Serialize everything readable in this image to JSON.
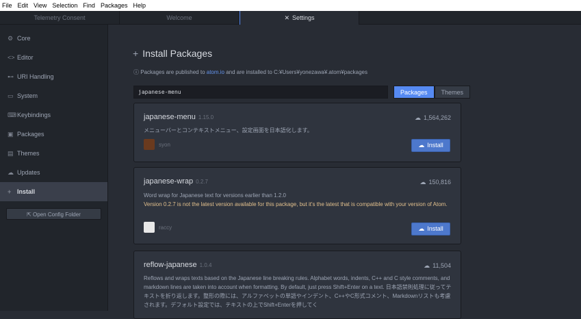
{
  "menubar": [
    "File",
    "Edit",
    "View",
    "Selection",
    "Find",
    "Packages",
    "Help"
  ],
  "tabs": [
    {
      "label": "Telemetry Consent"
    },
    {
      "label": "Welcome"
    },
    {
      "label": "Settings"
    }
  ],
  "sidebar": {
    "items": [
      {
        "label": "Core",
        "icon": "sliders-icon"
      },
      {
        "label": "Editor",
        "icon": "code-icon"
      },
      {
        "label": "URI Handling",
        "icon": "link-icon"
      },
      {
        "label": "System",
        "icon": "device-desktop-icon"
      },
      {
        "label": "Keybindings",
        "icon": "keyboard-icon"
      },
      {
        "label": "Packages",
        "icon": "package-icon"
      },
      {
        "label": "Themes",
        "icon": "paintcan-icon"
      },
      {
        "label": "Updates",
        "icon": "cloud-download-icon"
      },
      {
        "label": "Install",
        "icon": "plus-icon"
      }
    ],
    "config_button": "Open Config Folder"
  },
  "install": {
    "title": "Install Packages",
    "info_prefix": "Packages are published to ",
    "info_link": "atom.io",
    "info_suffix": " and are installed to C:¥Users¥yonezawa¥.atom¥packages",
    "search_value": "japanese-menu",
    "toggle_packages": "Packages",
    "toggle_themes": "Themes"
  },
  "packages": [
    {
      "name": "japanese-menu",
      "version": "1.15.0",
      "downloads": "1,564,262",
      "description": "メニューバーとコンテキストメニュー、設定画面を日本語化します。",
      "owner": "syon",
      "button": "Install"
    },
    {
      "name": "japanese-wrap",
      "version": "0.2.7",
      "downloads": "150,816",
      "description": "Word wrap for Japanese text for versions earlier than 1.2.0",
      "warning": "Version 0.2.7 is not the latest version available for this package, but it's the latest that is compatible with your version of Atom.",
      "owner": "raccy",
      "button": "Install"
    },
    {
      "name": "reflow-japanese",
      "version": "1.0.4",
      "downloads": "11,504",
      "description": "Reflows and wraps texts based on the Japanese line breaking rules. Alphabet words, indents, C++ and C style comments, and markdown lines are taken into account when formatting. By default, just press Shift+Enter on a text. 日本語禁則処理に従ってテキストを折り返します。整形の際には、アルファベットの単語やインデント、C++やC形式コメント、Markdownリストも考慮されます。デフォルト設定では、テキストの上でShift+Enterを押してく"
    }
  ],
  "colors": {
    "accent": "#568af2",
    "warning": "#e2c08d",
    "background": "#282c34"
  }
}
